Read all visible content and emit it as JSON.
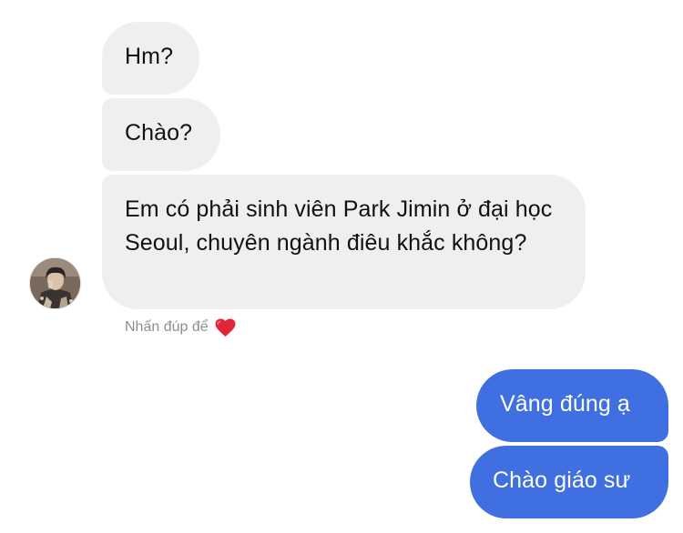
{
  "conversation": {
    "incoming": [
      {
        "text": "Hm?"
      },
      {
        "text": "Chào?"
      },
      {
        "text": "Em có phải sinh viên Park Jimin ở đại học Seoul, chuyên ngành điêu khắc không?"
      }
    ],
    "double_tap_hint": "Nhấn đúp để",
    "hint_icon": "heart-icon",
    "outgoing": [
      {
        "text": "Vâng đúng ạ"
      },
      {
        "text": "Chào giáo sư"
      }
    ]
  },
  "colors": {
    "incoming_bubble": "#efefef",
    "outgoing_bubble": "#3f6fe0",
    "hint_text": "#8e8e8e",
    "heart": "#e0253b"
  }
}
